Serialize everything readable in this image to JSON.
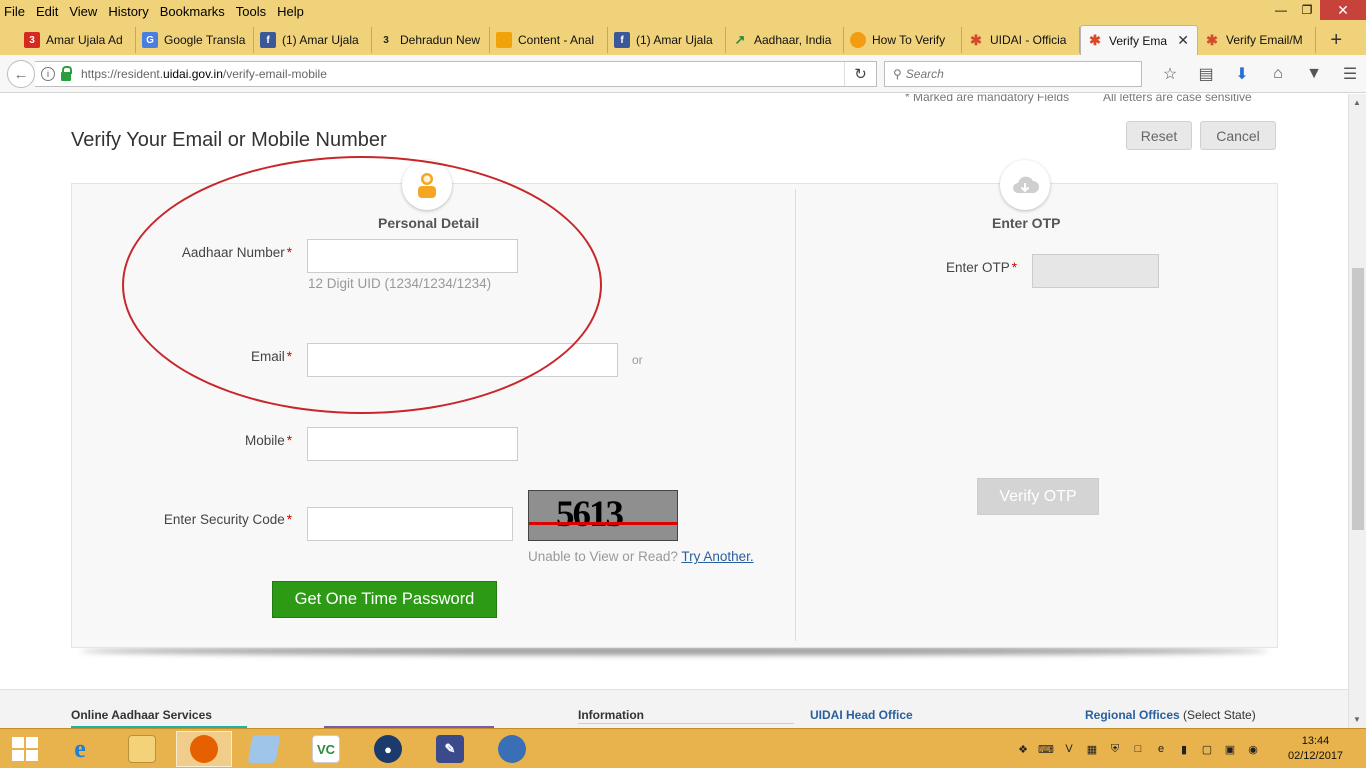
{
  "menu": [
    "File",
    "Edit",
    "View",
    "History",
    "Bookmarks",
    "Tools",
    "Help"
  ],
  "tabs": [
    {
      "label": "Amar Ujala Ad",
      "icon": "amar-ujala-icon",
      "color": "#d42a1f"
    },
    {
      "label": "Google Transla",
      "icon": "google-translate-icon",
      "color": "#4a7fe0"
    },
    {
      "label": "(1) Amar Ujala",
      "icon": "facebook-icon",
      "color": "#3b5998"
    },
    {
      "label": "Dehradun New",
      "icon": "amar-ujala-icon",
      "color": "#222222"
    },
    {
      "label": "Content - Anal",
      "icon": "analytics-icon",
      "color": "#f0a30a"
    },
    {
      "label": "(1) Amar Ujala",
      "icon": "facebook-icon",
      "color": "#3b5998"
    },
    {
      "label": "Aadhaar, India",
      "icon": "trend-icon",
      "color": "#2e8b3a"
    },
    {
      "label": "How To Verify",
      "icon": "circle-icon",
      "color": "#f39c12"
    },
    {
      "label": "UIDAI - Officia",
      "icon": "aadhaar-icon",
      "color": "#d44a2a"
    },
    {
      "label": "Verify Ema",
      "icon": "aadhaar-icon",
      "color": "#d44a2a"
    },
    {
      "label": "Verify Email/M",
      "icon": "aadhaar-icon",
      "color": "#d44a2a"
    }
  ],
  "nav": {
    "url_prefix": "https://resident.",
    "url_domain": "uidai.gov.in",
    "url_path": "/verify-email-mobile",
    "search_placeholder": "Search"
  },
  "page": {
    "top_note_1": "* Marked are mandatory Fields",
    "top_note_2": "All letters are case sensitive",
    "title": "Verify Your Email or Mobile Number",
    "reset_label": "Reset",
    "cancel_label": "Cancel",
    "personal_detail": "Personal Detail",
    "enter_otp_heading": "Enter OTP",
    "aadhaar_label": "Aadhaar Number",
    "aadhaar_hint": "12 Digit UID (1234/1234/1234)",
    "email_label": "Email",
    "or_text": "or",
    "mobile_label": "Mobile",
    "security_label": "Enter Security Code",
    "captcha_text": "5613",
    "unable_text": "Unable to View or Read?",
    "try_another": "Try Another.",
    "get_otp_label": "Get One Time Password",
    "otp_label": "Enter OTP",
    "verify_otp_label": "Verify OTP",
    "required_mark": "*"
  },
  "footer": {
    "col1": "Online Aadhaar Services",
    "col2": "Information",
    "col3": "UIDAI Head Office",
    "col4_bold": "Regional Offices",
    "col4_rest": "(Select State)"
  },
  "clock": {
    "time": "13:44",
    "date": "02/12/2017"
  },
  "colors": {
    "menubar": "#f0d27a",
    "taskbar": "#e8b24d",
    "green_button": "#2d9a16",
    "annotation_ellipse": "#c8262b"
  }
}
